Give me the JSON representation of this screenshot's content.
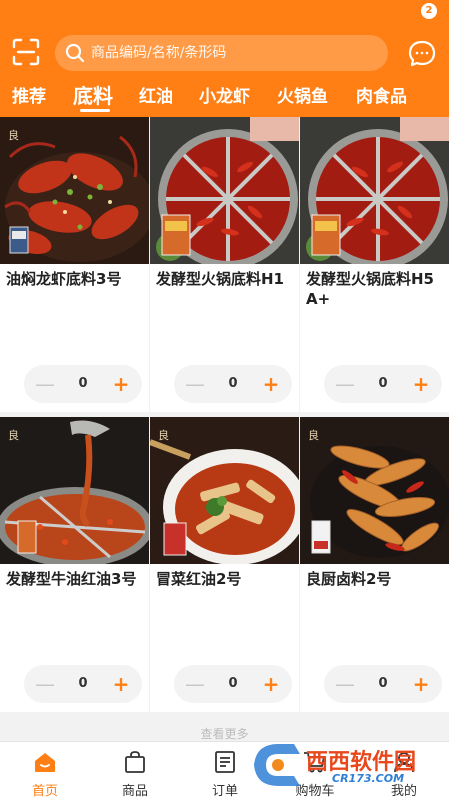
{
  "search": {
    "placeholder": "商品编码/名称/条形码"
  },
  "messages": {
    "badge_count": "2"
  },
  "categories": [
    {
      "label": "推荐",
      "active": false
    },
    {
      "label": "底料",
      "active": true
    },
    {
      "label": "红油",
      "active": false
    },
    {
      "label": "小龙虾",
      "active": false
    },
    {
      "label": "火锅鱼",
      "active": false
    },
    {
      "label": "肉食品",
      "active": false
    }
  ],
  "products": [
    {
      "name": "油焖龙虾底料3号",
      "quantity": "0"
    },
    {
      "name": "发酵型火锅底料H1",
      "quantity": "0"
    },
    {
      "name": "发酵型火锅底料H5A+",
      "quantity": "0"
    },
    {
      "name": "发酵型牛油红油3号",
      "quantity": "0"
    },
    {
      "name": "冒菜红油2号",
      "quantity": "0"
    },
    {
      "name": "良厨卤料2号",
      "quantity": "0"
    }
  ],
  "load_more": "查看更多",
  "tabbar": [
    {
      "label": "首页",
      "icon": "home-icon",
      "active": true
    },
    {
      "label": "商品",
      "icon": "bag-icon",
      "active": false
    },
    {
      "label": "订单",
      "icon": "order-icon",
      "active": false
    },
    {
      "label": "购物车",
      "icon": "cart-icon",
      "active": false
    },
    {
      "label": "我的",
      "icon": "user-icon",
      "active": false
    }
  ],
  "watermark": {
    "brand": "西西软件园",
    "domain": "CR173.COM"
  },
  "colors": {
    "accent": "#ff7f14",
    "background": "#f2f2f2"
  }
}
